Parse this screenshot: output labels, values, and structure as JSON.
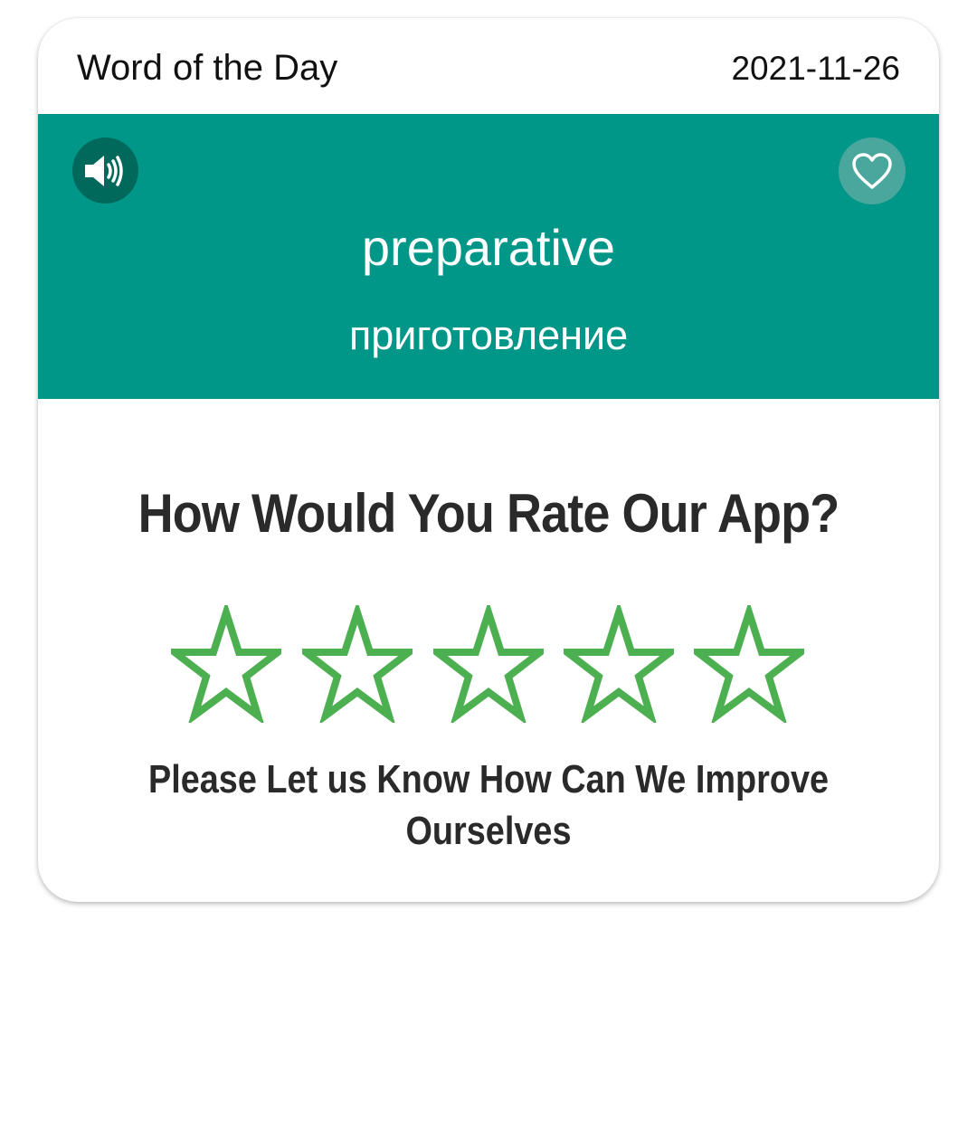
{
  "header": {
    "title": "Word of the Day",
    "date": "2021-11-26"
  },
  "word_panel": {
    "word": "preparative",
    "translation": "приготовление",
    "speaker_icon": "speaker-volume-icon",
    "favorite_icon": "heart-outline-icon",
    "background_color": "#009688"
  },
  "rating": {
    "title": "How Would You Rate Our App?",
    "subtitle": "Please Let us Know How Can We Improve Ourselves",
    "star_count": 5,
    "stars_filled": 0,
    "star_color": "#4caf50",
    "star_icon": "star-outline-icon"
  }
}
